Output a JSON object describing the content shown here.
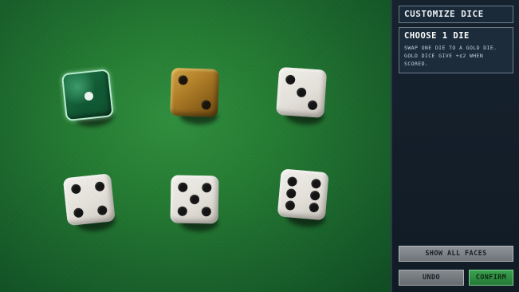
{
  "panel": {
    "title": "CUSTOMIZE DICE",
    "instruction_heading": "CHOOSE 1 DIE",
    "instruction_body": "SWAP ONE DIE TO A GOLD DIE. GOLD DICE GIVE +¢2 WHEN SCORED.",
    "show_all_faces_label": "SHOW ALL FACES",
    "undo_label": "UNDO",
    "confirm_label": "CONFIRM"
  },
  "dice": [
    {
      "material": "jade",
      "face": 1
    },
    {
      "material": "gold",
      "face": 2
    },
    {
      "material": "standard",
      "face": 3
    },
    {
      "material": "standard",
      "face": 4
    },
    {
      "material": "standard",
      "face": 5
    },
    {
      "material": "standard",
      "face": 6
    }
  ],
  "colors": {
    "felt": "#237a31",
    "panel": "#16222e",
    "gold_die": "#b07e26",
    "jade_die": "#1f7a4a",
    "confirm": "#3aa050"
  }
}
